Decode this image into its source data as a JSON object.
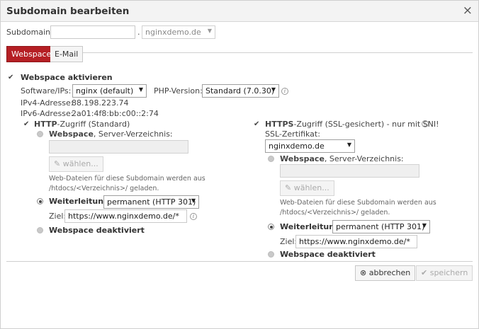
{
  "dialog": {
    "title": "Subdomain bearbeiten",
    "close": "×"
  },
  "subdomain": {
    "label": "Subdomain:",
    "value": "",
    "dot": ".",
    "domain": "nginxdemo.de"
  },
  "tabs": [
    {
      "label": "Webspace",
      "active": true
    },
    {
      "label": "E-Mail",
      "active": false
    }
  ],
  "webspace": {
    "enable_label": "Webspace aktivieren",
    "software_label": "Software/IPs:",
    "software_value": "nginx (default)",
    "php_label": "PHP-Version:",
    "php_value": "Standard (7.0.30)",
    "ipv4_label": "IPv4-Adresse:",
    "ipv4": "88.198.223.74",
    "ipv6_label": "IPv6-Adresse:",
    "ipv6": "2a01:4f8:bb:c00::2:74"
  },
  "http": {
    "title_bold": "HTTP",
    "title_rest": "-Zugriff (Standard)",
    "webspace_bold": "Webspace",
    "webspace_rest": ", Server-Verzeichnis:",
    "dir_value": "",
    "choose_label": "wählen...",
    "help_line1": "Web-Dateien für diese Subdomain werden aus",
    "help_line2": "/htdocs/<Verzeichnis>/ geladen.",
    "redirect_label": "Weiterleitung",
    "redirect_type": "permanent (HTTP 301)",
    "target_label": "Ziel:",
    "target_value": "https://www.nginxdemo.de/*",
    "disabled_label": "Webspace deaktiviert"
  },
  "https": {
    "title_bold": "HTTPS",
    "title_rest": "-Zugriff (SSL-gesichert) - nur mit SNI!",
    "cert_label": "SSL-Zertifikat:",
    "cert_value": "nginxdemo.de",
    "webspace_bold": "Webspace",
    "webspace_rest": ", Server-Verzeichnis:",
    "dir_value": "",
    "choose_label": "wählen...",
    "help_line1": "Web-Dateien für diese Subdomain werden aus",
    "help_line2": "/htdocs/<Verzeichnis>/ geladen.",
    "redirect_label": "Weiterleitung",
    "redirect_type": "permanent (HTTP 301)",
    "target_label": "Ziel:",
    "target_value": "https://www.nginxdemo.de/*",
    "disabled_label": "Webspace deaktiviert"
  },
  "footer": {
    "cancel_label": "abbrechen",
    "save_label": "speichern"
  },
  "colors": {
    "accent": "#b51f24"
  }
}
